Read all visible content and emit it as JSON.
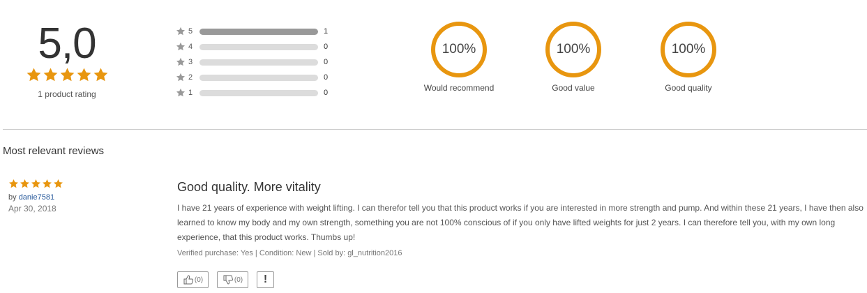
{
  "summary": {
    "average_score": "5,0",
    "average_stars": 5,
    "rating_count_label": "1 product rating",
    "distribution": [
      {
        "stars_label": "5",
        "count": "1",
        "fraction": 1.0
      },
      {
        "stars_label": "4",
        "count": "0",
        "fraction": 0
      },
      {
        "stars_label": "3",
        "count": "0",
        "fraction": 0
      },
      {
        "stars_label": "2",
        "count": "0",
        "fraction": 0
      },
      {
        "stars_label": "1",
        "count": "0",
        "fraction": 0
      }
    ],
    "metrics": [
      {
        "value": "100%",
        "label": "Would recommend"
      },
      {
        "value": "100%",
        "label": "Good value"
      },
      {
        "value": "100%",
        "label": "Good quality"
      }
    ]
  },
  "reviews_section": {
    "title": "Most relevant reviews",
    "reviews": [
      {
        "stars": 5,
        "by_prefix": "by",
        "author": "danie7581",
        "date": "Apr 30, 2018",
        "title": "Good quality. More vitality",
        "text": "I have 21 years of experience with weight lifting. I can therefor tell you that this product works if you are interested in more strength and pump. And within these 21 years, I have then also learned to know my body and my own strength, something you are not 100% conscious of if you only have lifted weights for just 2 years. I can therefore tell you, with my own long experience, that this product works.  Thumbs up!",
        "footer": "Verified purchase: Yes | Condition: New | Sold by: gl_nutrition2016",
        "like_count": "(0)",
        "dislike_count": "(0)",
        "report_label": "!"
      }
    ]
  },
  "colors": {
    "star_gold": "#e8960f",
    "star_grey": "#999999",
    "bar_fill": "#999999",
    "bar_track": "#dcdcdc",
    "ring": "#e8960f",
    "author_link": "#2a5b9c"
  },
  "icons": {
    "star": "star-icon",
    "like": "thumbs-up-icon",
    "dislike": "thumbs-down-icon",
    "report": "report-icon"
  }
}
